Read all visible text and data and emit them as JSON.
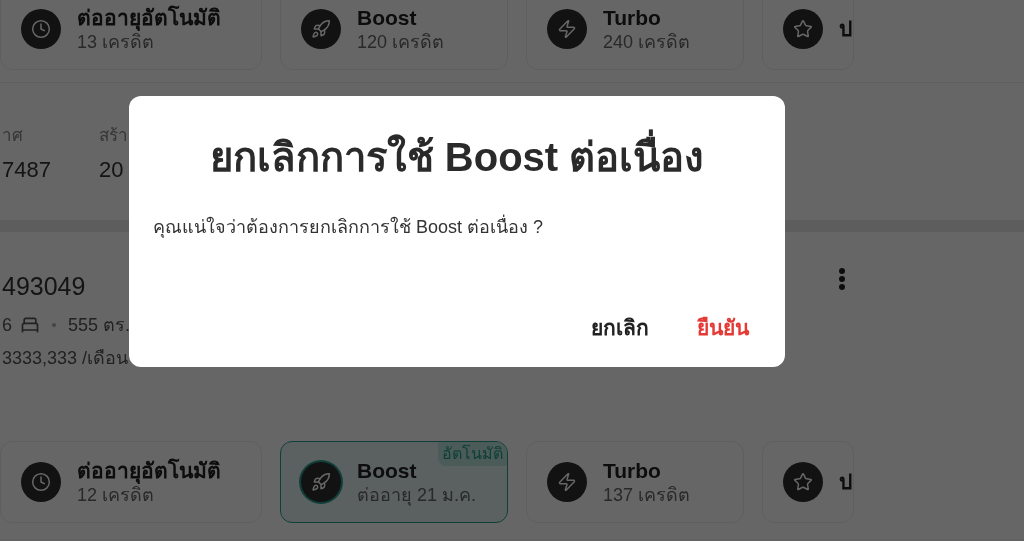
{
  "top_cards": [
    {
      "kind": "clock",
      "title": "ต่ออายุอัตโนมัติ",
      "subtitle": "13 เครดิต",
      "selected": false
    },
    {
      "kind": "rocket",
      "title": "Boost",
      "subtitle": "120 เครดิต",
      "selected": false
    },
    {
      "kind": "zap",
      "title": "Turbo",
      "subtitle": "240 เครดิต",
      "selected": false
    },
    {
      "kind": "star",
      "title": "ป",
      "selected": false
    }
  ],
  "stats": [
    {
      "label": "าศ",
      "value": "7487"
    },
    {
      "label": "สร้า",
      "value": "20"
    }
  ],
  "listing": {
    "id": "493049",
    "bedrooms": "6",
    "area": "555 ตร.",
    "price": "3333,333 /เดือน"
  },
  "bottom_cards": [
    {
      "kind": "clock",
      "title": "ต่ออายุอัตโนมัติ",
      "subtitle": "12 เครดิต",
      "selected": false
    },
    {
      "kind": "rocket",
      "title": "Boost",
      "subtitle": "ต่ออายุ 21 ม.ค.",
      "badge": "อัตโนมัติ",
      "selected": true
    },
    {
      "kind": "zap",
      "title": "Turbo",
      "subtitle": "137 เครดิต",
      "selected": false
    },
    {
      "kind": "star",
      "title": "ป",
      "selected": false
    }
  ],
  "dialog": {
    "title": "ยกเลิกการใช้ Boost ต่อเนื่อง",
    "message": "คุณแน่ใจว่าต้องการยกเลิกการใช้ Boost ต่อเนื่อง ?",
    "buttons": [
      {
        "label": "ยกเลิก",
        "kind": "cancel"
      },
      {
        "label": "ยืนยัน",
        "kind": "confirm"
      }
    ]
  }
}
